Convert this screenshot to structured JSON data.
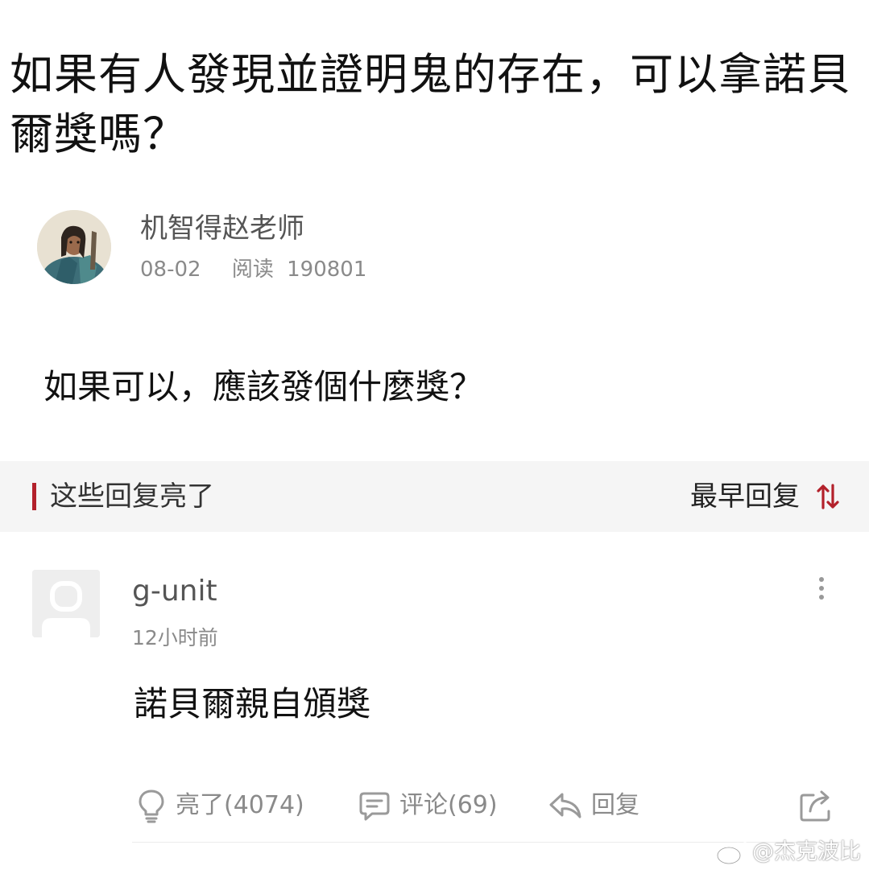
{
  "post": {
    "title": "如果有人發現並證明鬼的存在，可以拿諾貝爾獎嗎？",
    "author": {
      "name": "机智得赵老师",
      "date": "08-02",
      "read_label": "阅读",
      "read_count": "190801"
    },
    "body": "如果可以，應該發個什麼獎？"
  },
  "section": {
    "title": "这些回复亮了",
    "sort_label": "最早回复",
    "accent_color": "#b3212b"
  },
  "reply": {
    "username": "g-unit",
    "time": "12小时前",
    "body": "諾貝爾親自頒獎",
    "actions": {
      "light": "亮了(4074)",
      "comment": "评论(69)",
      "reply": "回复"
    }
  },
  "watermark": {
    "text": "@杰克波比"
  },
  "icons": {
    "avatar": "author-avatar",
    "default_avatar": "user-placeholder-icon",
    "sort": "sort-arrows-icon",
    "more": "more-vertical-icon",
    "light": "lightbulb-icon",
    "comment": "comment-bubble-icon",
    "reply": "reply-arrow-icon",
    "share": "share-icon",
    "weibo": "weibo-icon"
  }
}
